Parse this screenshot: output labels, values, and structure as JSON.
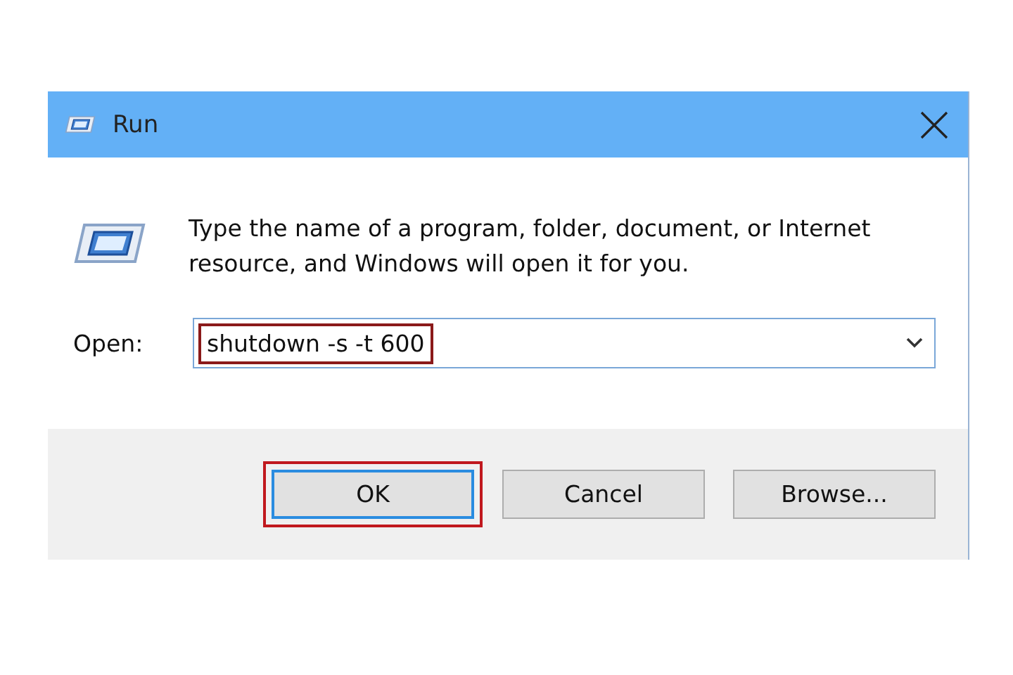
{
  "window": {
    "title": "Run"
  },
  "message": "Type the name of a program, folder, document, or Internet resource, and Windows will open it for you.",
  "open_field": {
    "label": "Open:",
    "value": "shutdown -s -t 600",
    "highlighted": true
  },
  "buttons": [
    {
      "label": "OK",
      "default": true,
      "highlighted": true
    },
    {
      "label": "Cancel",
      "default": false,
      "highlighted": false
    },
    {
      "label": "Browse...",
      "default": false,
      "highlighted": false
    }
  ]
}
